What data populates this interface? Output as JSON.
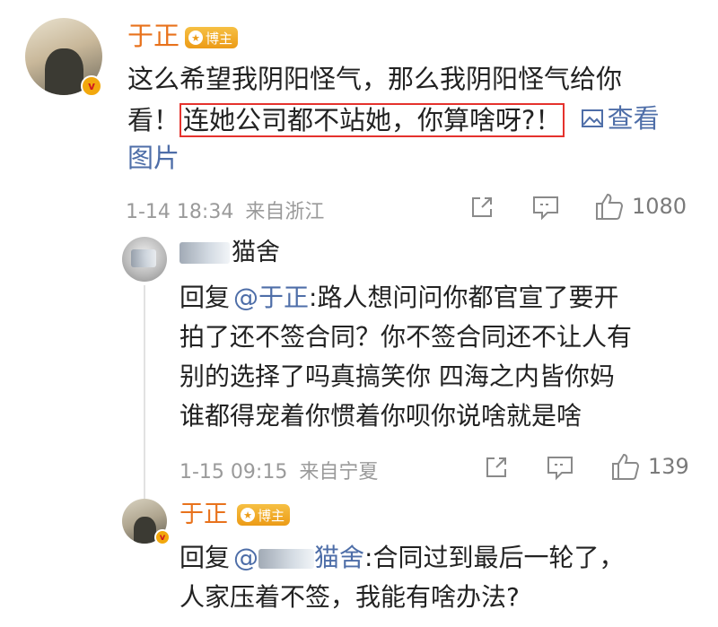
{
  "post": {
    "author": "于正",
    "badge": "博主",
    "verified_mark": "v",
    "text_line1": "这么希望我阴阳怪气，那么我阴阳怪气给你",
    "text_line2_start": "看！",
    "highlighted_text": "连她公司都不站她，你算啥呀?！",
    "view_image_link_a": "查看",
    "view_image_link_b": "图片",
    "timestamp": "1-14 18:34",
    "source": "来自浙江",
    "likes": "1080"
  },
  "reply1": {
    "author_visible": "猫舍",
    "author_prefix_obscured": "ᅲ芸",
    "text_line1_prefix": "回复",
    "mention": "@于正",
    "text_line1": ":路人想问问你都官宣了要开",
    "text_line2": "拍了还不签合同？你不签合同还不让人有",
    "text_line3": "别的选择了吗真搞笑你 四海之内皆你妈",
    "text_line4": "谁都得宠着你惯着你呗你说啥就是啥",
    "timestamp": "1-15 09:15",
    "source": "来自宁夏",
    "likes": "139"
  },
  "reply2": {
    "author": "于正",
    "badge": "博主",
    "verified_mark": "v",
    "text_prefix": "回复",
    "mention_visible_start": "@",
    "mention_visible_end": "猫舍",
    "text_line1": ":合同过到最后一轮了，",
    "text_line2": "人家压着不签，我能有啥办法?"
  },
  "icons": {
    "view_image": "image-icon",
    "share": "share-icon",
    "comment": "comment-icon",
    "like": "thumbs-up-icon"
  },
  "colors": {
    "name": "#e8721c",
    "link": "#4e6ea8",
    "highlight_border": "#e5322d",
    "meta": "#9a9a9a"
  }
}
